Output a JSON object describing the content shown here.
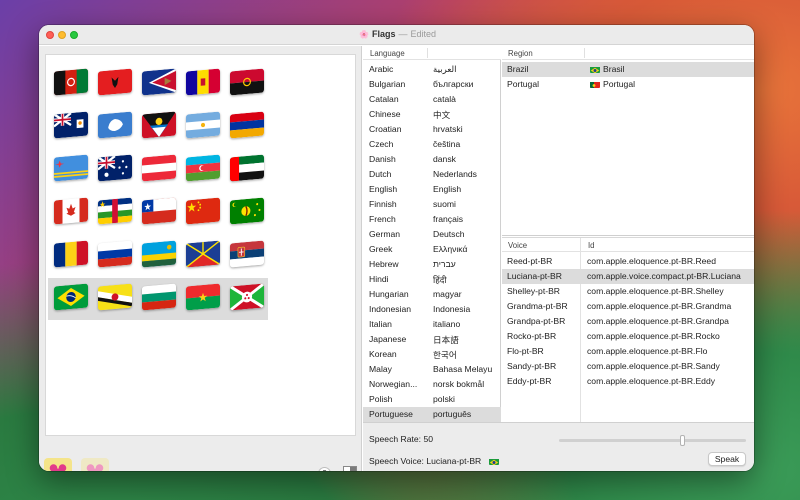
{
  "window": {
    "title": "Flags",
    "separator": "—",
    "edited": "Edited",
    "app_icon": "flags-app-icon"
  },
  "flags": {
    "rows": [
      [
        "Afghanistan",
        "Albania",
        "American Samoa",
        "Andorra",
        "Angola"
      ],
      [
        "Anguilla",
        "Antarctica",
        "Antigua and Barbuda",
        "Argentina",
        "Armenia"
      ],
      [
        "Aruba",
        "Australia",
        "Austria",
        "Azerbaijan",
        "United Arab Emirates"
      ],
      [
        "Canada",
        "Central African Republic",
        "Chile",
        "China",
        "Cocos Islands"
      ],
      [
        "Romania",
        "Russia",
        "Rwanda",
        "Réunion",
        "Serbia"
      ],
      [
        "Brazil",
        "Brunei",
        "Bulgaria",
        "Burkina Faso",
        "Burundi"
      ]
    ],
    "selected_row": 5
  },
  "toolbar_left": {
    "tool1_icon": "mickey-pink-icon",
    "tool2_icon": "mickey-pink-icon",
    "help_label": "?",
    "split_icon": "split-view-icon"
  },
  "language_list": {
    "header_language": "Language",
    "items": [
      {
        "en": "Arabic",
        "native": "العربية"
      },
      {
        "en": "Bulgarian",
        "native": "български"
      },
      {
        "en": "Catalan",
        "native": "català"
      },
      {
        "en": "Chinese",
        "native": "中文"
      },
      {
        "en": "Croatian",
        "native": "hrvatski"
      },
      {
        "en": "Czech",
        "native": "čeština"
      },
      {
        "en": "Danish",
        "native": "dansk"
      },
      {
        "en": "Dutch",
        "native": "Nederlands"
      },
      {
        "en": "English",
        "native": "English"
      },
      {
        "en": "Finnish",
        "native": "suomi"
      },
      {
        "en": "French",
        "native": "français"
      },
      {
        "en": "German",
        "native": "Deutsch"
      },
      {
        "en": "Greek",
        "native": "Ελληνικά"
      },
      {
        "en": "Hebrew",
        "native": "עברית"
      },
      {
        "en": "Hindi",
        "native": "हिंदी"
      },
      {
        "en": "Hungarian",
        "native": "magyar"
      },
      {
        "en": "Indonesian",
        "native": "Indonesia"
      },
      {
        "en": "Italian",
        "native": "italiano"
      },
      {
        "en": "Japanese",
        "native": "日本語"
      },
      {
        "en": "Korean",
        "native": "한국어"
      },
      {
        "en": "Malay",
        "native": "Bahasa Melayu"
      },
      {
        "en": "Norwegian...",
        "native": "norsk bokmål"
      },
      {
        "en": "Polish",
        "native": "polski"
      },
      {
        "en": "Portuguese",
        "native": "português"
      }
    ],
    "selected_index": 23
  },
  "region_list": {
    "header": "Region",
    "items": [
      {
        "name": "Brazil",
        "native": "Brasil",
        "flag": "brazil-flag"
      },
      {
        "name": "Portugal",
        "native": "Portugal",
        "flag": "portugal-flag"
      }
    ],
    "selected_index": 0
  },
  "voice_list": {
    "header_voice": "Voice",
    "header_id": "Id",
    "items": [
      {
        "name": "Reed-pt-BR",
        "id": "com.apple.eloquence.pt-BR.Reed"
      },
      {
        "name": "Luciana-pt-BR",
        "id": "com.apple.voice.compact.pt-BR.Luciana"
      },
      {
        "name": "Shelley-pt-BR",
        "id": "com.apple.eloquence.pt-BR.Shelley"
      },
      {
        "name": "Grandma-pt-BR",
        "id": "com.apple.eloquence.pt-BR.Grandma"
      },
      {
        "name": "Grandpa-pt-BR",
        "id": "com.apple.eloquence.pt-BR.Grandpa"
      },
      {
        "name": "Rocko-pt-BR",
        "id": "com.apple.eloquence.pt-BR.Rocko"
      },
      {
        "name": "Flo-pt-BR",
        "id": "com.apple.eloquence.pt-BR.Flo"
      },
      {
        "name": "Sandy-pt-BR",
        "id": "com.apple.eloquence.pt-BR.Sandy"
      },
      {
        "name": "Eddy-pt-BR",
        "id": "com.apple.eloquence.pt-BR.Eddy"
      }
    ],
    "selected_index": 1
  },
  "controls": {
    "speech_rate_label": "Speech Rate: 50",
    "speech_rate_fraction": 0.66,
    "speech_voice_label": "Speech Voice: Luciana-pt-BR",
    "speak_label": "Speak"
  },
  "colors": {
    "selection": "#dcdcdc",
    "tool_button": "#f4e48a"
  }
}
